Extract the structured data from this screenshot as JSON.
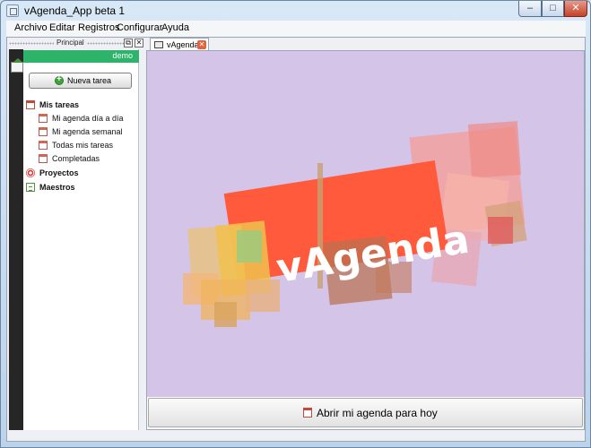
{
  "window": {
    "title": "vAgenda_App beta 1",
    "controls": {
      "minimize": "–",
      "maximize": "□",
      "close": "✕"
    }
  },
  "menubar": {
    "items": [
      "Archivo",
      "Editar",
      "Registros",
      "Configurar",
      "Ayuda"
    ]
  },
  "dock": {
    "title": "Principal",
    "float_glyph": "⧉",
    "close_glyph": "✕",
    "user": "demo",
    "new_task_label": "Nueva tarea",
    "tree": [
      {
        "label": "Mis tareas",
        "icon": "calendar-icon"
      },
      {
        "label": "Mi agenda día a día",
        "icon": "calendar-icon"
      },
      {
        "label": "Mi agenda semanal",
        "icon": "calendar-icon"
      },
      {
        "label": "Todas mis tareas",
        "icon": "calendar-icon"
      },
      {
        "label": "Completadas",
        "icon": "calendar-icon"
      },
      {
        "label": "Proyectos",
        "icon": "target-icon"
      },
      {
        "label": "Maestros",
        "icon": "document-icon"
      }
    ]
  },
  "tabs": [
    {
      "label": "vAgenda",
      "close_glyph": "✕"
    }
  ],
  "splash": {
    "logo_text": "vAgenda",
    "background_color": "#d3c4e8",
    "banner_color": "#ff5a3c"
  },
  "actions": {
    "open_today_label": "Abrir mi agenda para hoy"
  }
}
